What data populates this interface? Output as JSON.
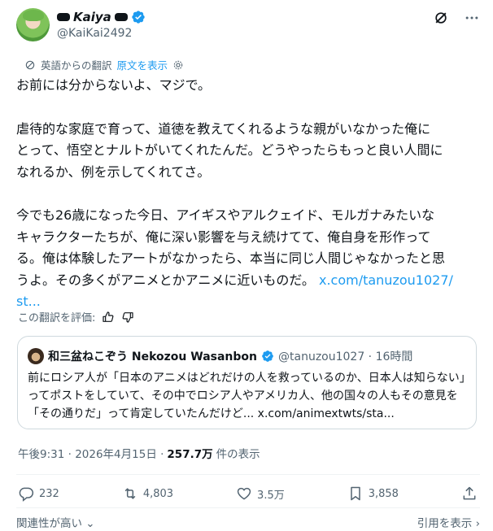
{
  "author": {
    "display_name": "Kaiya",
    "handle": "@KaiKai2492"
  },
  "translation": {
    "label": "英語からの翻訳",
    "show_original": "原文を表示"
  },
  "post": {
    "para1": "お前には分からないよ、マジで。",
    "para2": "虐待的な家庭で育って、道徳を教えてくれるような親がいなかった俺に\nとって、悟空とナルトがいてくれたんだ。どうやったらもっと良い人間に\nなれるか、例を示してくれてさ。",
    "para3": "今でも26歳になった今日、アイギスやアルクェイド、モルガナみたいな\nキャラクターたちが、俺に深い影響を与え続けてて、俺自身を形作って\nる。俺は体験したアートがなかったら、本当に同じ人間じゃなかったと思\nうよ。その多くがアニメとかアニメに近いものだ。 ",
    "link": "x.com/tanuzou1027/\nst..."
  },
  "rate_translation": "この翻訳を評価:",
  "quote": {
    "name": "和三盆ねこぞう Nekozou Wasanbon",
    "handle_time": "@tanuzou1027 · 16時間",
    "text": "前にロシア人が「日本のアニメはどれだけの人を救っているのか、日本人は知らない」ってポストをしていて、その中でロシア人やアメリカ人、他の国々の人もその意見を「その通りだ」って肯定していたんだけど... x.com/animextwts/sta..."
  },
  "meta": {
    "time": "午後9:31 · 2026年4月15日 · ",
    "views": "257.7万",
    "views_label": "件の表示"
  },
  "actions": {
    "replies": "232",
    "reposts": "4,803",
    "likes": "3.5万",
    "bookmarks": "3,858"
  },
  "footer": {
    "sort": "関連性が高い",
    "quotes": "引用を表示 ›"
  },
  "colors": {
    "accent": "#1d9bf0",
    "muted": "#536471",
    "text": "#0f1419",
    "border": "#cfd9de"
  }
}
